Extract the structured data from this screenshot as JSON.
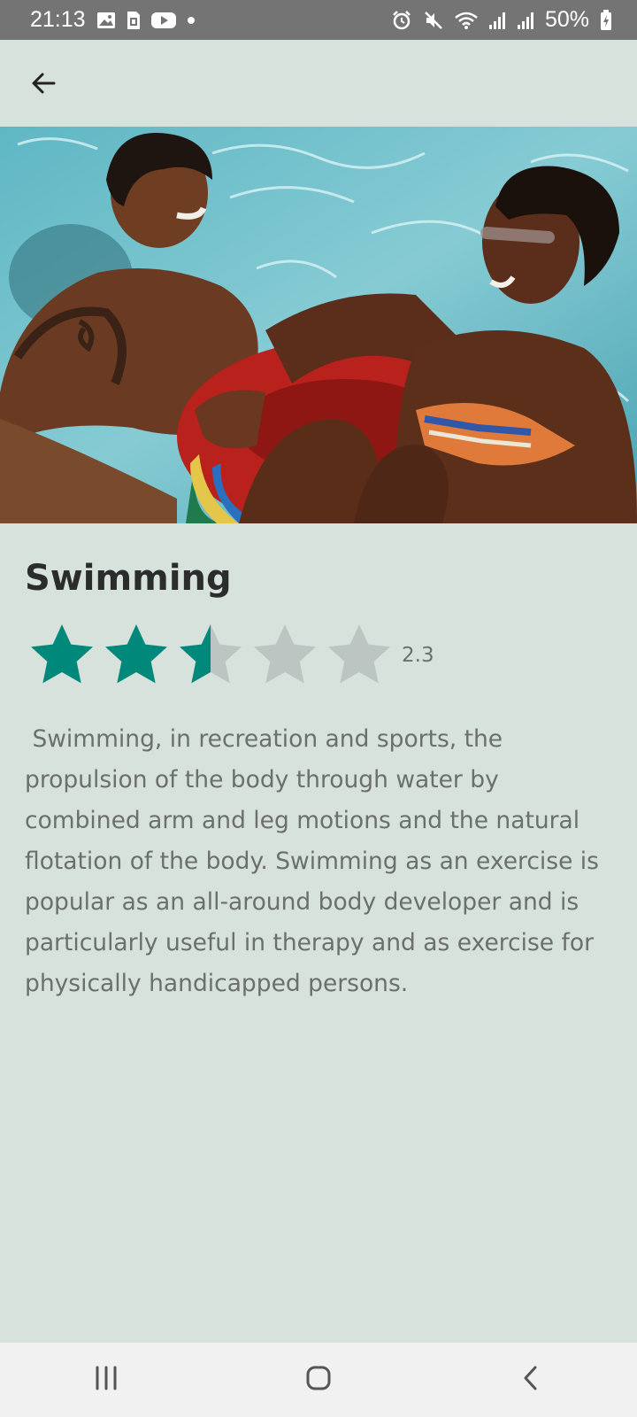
{
  "status_bar": {
    "time": "21:13",
    "battery": "50%",
    "left_icons": [
      "gallery-icon",
      "sim-icon",
      "youtube-icon",
      "dot-icon"
    ],
    "right_icons": [
      "alarm-icon",
      "mute-icon",
      "wifi-icon",
      "signal-icon",
      "signal-icon",
      "battery-icon"
    ]
  },
  "app_bar": {
    "back_icon": "arrow-left-icon"
  },
  "activity": {
    "title": "Swimming",
    "rating": 2.3,
    "rating_label": "2.3",
    "rating_max": 5,
    "description": " Swimming, in recreation and sports, the propulsion of the body through water by combined arm and leg motions and the natural flotation of the body. Swimming as an exercise is popular as an all-around body developer and is particularly useful in therapy and as exercise for physically handicapped persons."
  },
  "nav_bar": {
    "icons": [
      "recents-icon",
      "home-icon",
      "back-icon"
    ]
  },
  "colors": {
    "background": "#d8e2dc",
    "star_filled": "#00897b",
    "star_empty": "#bcc5c1",
    "title_text": "#2a2d2c",
    "body_text": "#6b6f6d",
    "status_bar": "#747474"
  }
}
